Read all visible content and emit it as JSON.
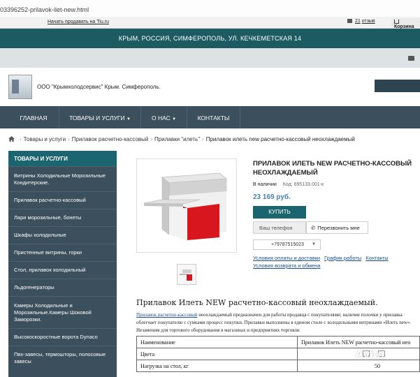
{
  "browser": {
    "url_fragment": "03396252-prilavok-ilet-new.html"
  },
  "topbar": {
    "sell_label": "Начать продавать на Tiu.ru",
    "reviews_count": "21",
    "reviews_label": "отзыв",
    "cart_label": "Корзина"
  },
  "address": "КРЫМ, РОССИЯ, СИМФЕРОПОЛЬ, УЛ. КЕЧКЕМЕТСКАЯ 14",
  "company": {
    "name": "ООО \"Крымхолодсервис\" Крым. Симферополь."
  },
  "nav": {
    "items": [
      "ГЛАВНАЯ",
      "ТОВАРЫ И УСЛУГИ",
      "О НАС",
      "КОНТАКТЫ"
    ]
  },
  "breadcrumb": [
    "Товары и услуги",
    "Прилавок расчетно-кассовый",
    "Прилавки \"илеть\"",
    "Прилавок илеть new расчетно-кассовый неохлаждаемый"
  ],
  "sidebar": {
    "title": "ТОВАРЫ И УСЛУГИ",
    "items": [
      "Витрины Холодильные Морозильные Кондитерские.",
      "Прилавок расчетно-кассовый",
      "Лари морозильные, бонеты",
      "Шкафы холодильные",
      "Пристенные витрины, горки",
      "Стол, прилавок холодильный",
      "Льдогенераторы",
      "Камеры Холодильные и Морозильные.Камеры Шоковой Заморозки.",
      "Высокоскоростные ворота Dynaco",
      "Пвх-завесы, термошторы, полосовые завесы"
    ]
  },
  "product": {
    "title": "ПРИЛАВОК ИЛЕТЬ NEW РАСЧЕТНО-КАССОВЫЙ НЕОХЛАЖДАЕМЫЙ",
    "stock": "В наличии",
    "code": "Код: 695133.001-к",
    "price": "23 169 руб.",
    "buy_label": "КУПИТЬ",
    "phone_placeholder": "Ваш телефон",
    "callback_label": "Перезвонить мне",
    "phone": "+79787515023",
    "links_row1": [
      "Условия оплаты и доставки",
      "График работы",
      "Контакты"
    ],
    "links_row2": "Условия возврата и обмена"
  },
  "description": {
    "title": "Прилавок Илеть NEW расчетно-кассовый неохлаждаемый.",
    "link": "Прилавок расчетно-кассовый",
    "text": " неохлаждаемый предназначен для работы продавца с покупателями; наличие полочки у прилавка облегчает покупателю с сумками процесс покупки. Прилавки выполнены в едином стиле с холодильными витринами «Илеть new». Незаменим для торгового оборудования в магазинах и предприятиях торговли"
  },
  "specs": {
    "rows": [
      {
        "name": "Наименование",
        "value": "Прилавок Илеть NEW расчетно-кассовый нео"
      },
      {
        "name": "Цвета",
        "value": ""
      },
      {
        "name": "Нагрузка на стол, кг",
        "value": "50"
      }
    ]
  },
  "watermark": "Avito",
  "colors": {
    "teal": "#1b6571",
    "nav": "#3b4f5c",
    "price": "#4a7fb0",
    "cabinet_red": "#d8161d"
  }
}
